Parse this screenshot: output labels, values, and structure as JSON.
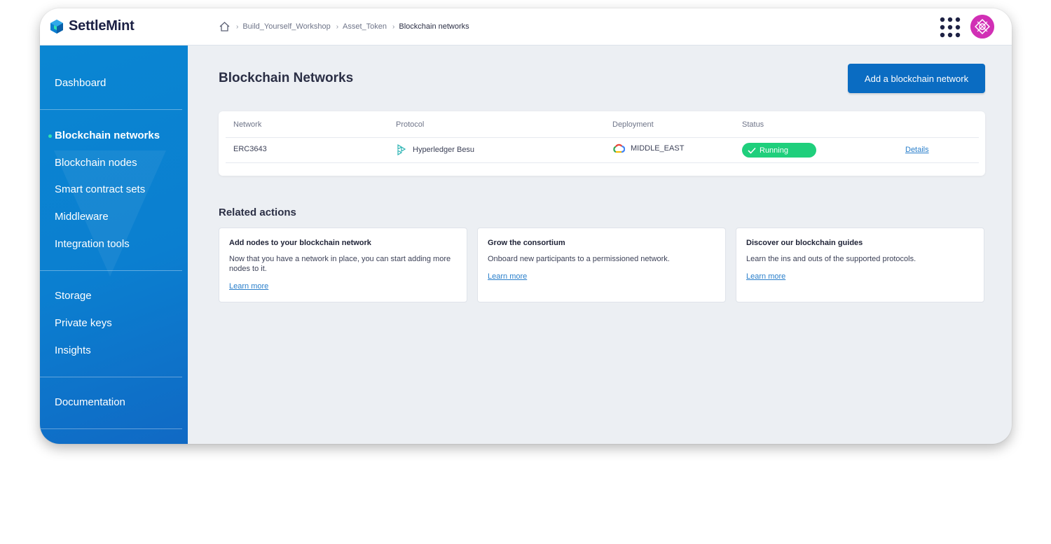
{
  "brand": {
    "name": "SettleMint"
  },
  "breadcrumb": [
    "Build_Yourself_Workshop",
    "Asset_Token",
    "Blockchain networks"
  ],
  "sidebar": {
    "groups": [
      [
        "Dashboard"
      ],
      [
        "Blockchain networks",
        "Blockchain nodes",
        "Smart contract sets",
        "Middleware",
        "Integration tools"
      ],
      [
        "Storage",
        "Private keys",
        "Insights"
      ],
      [
        "Documentation"
      ]
    ],
    "active": "Blockchain networks"
  },
  "main": {
    "title": "Blockchain Networks",
    "add_button": "Add a blockchain network",
    "table": {
      "headers": [
        "Network",
        "Protocol",
        "Deployment",
        "Status"
      ],
      "rows": [
        {
          "network": "ERC3643",
          "protocol": "Hyperledger Besu",
          "deployment": "MIDDLE_EAST",
          "status": "Running",
          "action": "Details"
        }
      ]
    },
    "related_title": "Related actions",
    "related": [
      {
        "title": "Add nodes to your blockchain network",
        "text": "Now that you have a network in place, you can start adding more nodes to it.",
        "link": "Learn more"
      },
      {
        "title": "Grow the consortium",
        "text": "Onboard new participants to a permissioned network.",
        "link": "Learn more"
      },
      {
        "title": "Discover our blockchain guides",
        "text": "Learn the ins and outs of the supported protocols.",
        "link": "Learn more"
      }
    ]
  },
  "icons": [
    "settlemint-logo-icon",
    "home-icon",
    "chevron-right-icon",
    "apps-grid-icon",
    "avatar",
    "hyperledger-besu-icon",
    "google-cloud-icon",
    "check-icon"
  ],
  "colors": {
    "sidebar": "#0a86d2",
    "primary_button": "#0a6cc2",
    "status_running": "#1fcf7c",
    "link": "#2a7fcb",
    "avatar": "#d12fb5"
  }
}
